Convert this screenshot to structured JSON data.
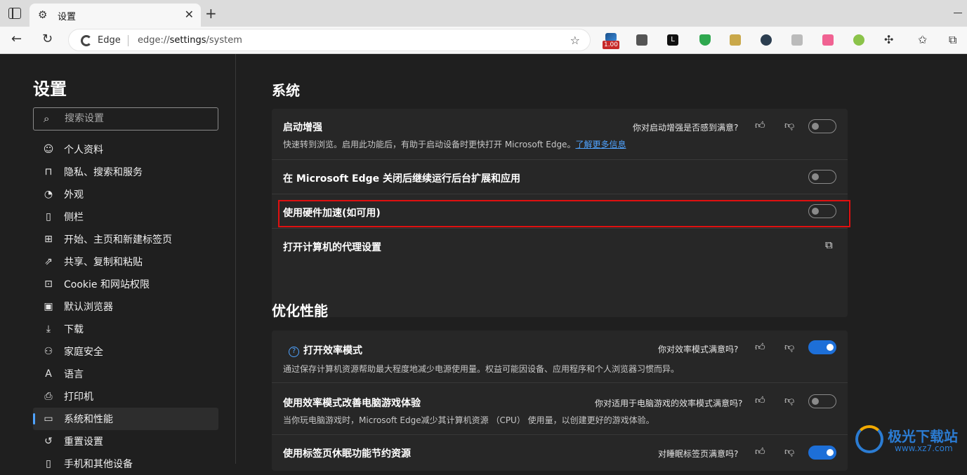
{
  "browser": {
    "tab_title": "设置",
    "address_brand": "Edge",
    "url_prefix": "edge://",
    "url_host": "settings",
    "url_path": "/system",
    "extension_badge": "1.00"
  },
  "sidebar": {
    "title": "设置",
    "search_placeholder": "搜索设置",
    "items": [
      {
        "label": "个人资料",
        "icon": "profile-icon"
      },
      {
        "label": "隐私、搜索和服务",
        "icon": "lock-icon"
      },
      {
        "label": "外观",
        "icon": "palette-icon"
      },
      {
        "label": "侧栏",
        "icon": "sidebar-icon"
      },
      {
        "label": "开始、主页和新建标签页",
        "icon": "home-icon"
      },
      {
        "label": "共享、复制和粘贴",
        "icon": "share-icon"
      },
      {
        "label": "Cookie 和网站权限",
        "icon": "cookie-icon"
      },
      {
        "label": "默认浏览器",
        "icon": "browser-icon"
      },
      {
        "label": "下载",
        "icon": "download-icon"
      },
      {
        "label": "家庭安全",
        "icon": "family-icon"
      },
      {
        "label": "语言",
        "icon": "language-icon"
      },
      {
        "label": "打印机",
        "icon": "printer-icon"
      },
      {
        "label": "系统和性能",
        "icon": "system-icon",
        "active": true
      },
      {
        "label": "重置设置",
        "icon": "reset-icon"
      },
      {
        "label": "手机和其他设备",
        "icon": "phone-icon"
      }
    ]
  },
  "system": {
    "title": "系统",
    "startup_boost": {
      "label": "启动增强",
      "desc": "快速转到浏览。启用此功能后，有助于启动设备时更快打开 Microsoft Edge。",
      "link": "了解更多信息",
      "feedback": "你对启动增强是否感到满意?",
      "on": false
    },
    "background_run": {
      "label": "在 Microsoft Edge 关闭后继续运行后台扩展和应用",
      "on": false
    },
    "hardware_accel": {
      "label": "使用硬件加速(如可用)",
      "on": false
    },
    "proxy": {
      "label": "打开计算机的代理设置"
    }
  },
  "performance": {
    "title": "优化性能",
    "efficiency_mode": {
      "label": "打开效率模式",
      "desc": "通过保存计算机资源帮助最大程度地减少电源使用量。权益可能因设备、应用程序和个人浏览器习惯而异。",
      "feedback": "你对效率模式满意吗?",
      "on": true
    },
    "gaming": {
      "label": "使用效率模式改善电脑游戏体验",
      "desc": "当你玩电脑游戏时，Microsoft Edge减少其计算机资源 （CPU） 使用量，以创建更好的游戏体验。",
      "feedback": "你对适用于电脑游戏的效率模式满意吗?",
      "on": false
    },
    "sleeping_tabs": {
      "label": "使用标签页休眠功能节约资源",
      "feedback": "对睡眠标签页满意吗?",
      "on": true
    }
  },
  "watermark": {
    "name": "极光下载站",
    "url": "www.xz7.com"
  }
}
